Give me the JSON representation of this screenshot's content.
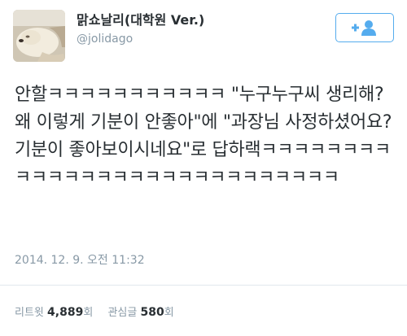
{
  "user": {
    "display_name": "맑쇼날리(대학원 Ver.)",
    "handle": "@jolidago",
    "avatar_icon": "avatar-photo"
  },
  "follow_button": {
    "icon": "add-user-icon",
    "color": "#55acee"
  },
  "tweet": {
    "text": "안할ㅋㅋㅋㅋㅋㅋㅋㅋㅋㅋㅋ \"누구누구씨 생리해? 왜 이렇게 기분이 안좋아\"에 \"과장님 사정하셨어요? 기분이 좋아보이시네요\"로 답하랙ㅋㅋㅋㅋㅋㅋㅋㅋㅋㅋㅋㅋㅋㅋㅋㅋㅋㅋㅋㅋㅋㅋㅋㅋㅋㅋㅋㅋ",
    "timestamp": "2014. 12. 9. 오전 11:32"
  },
  "stats": {
    "retweets_label": "리트윗",
    "retweets_count": "4,889",
    "retweets_unit": "회",
    "favorites_label": "관심글",
    "favorites_count": "580",
    "favorites_unit": "회"
  }
}
